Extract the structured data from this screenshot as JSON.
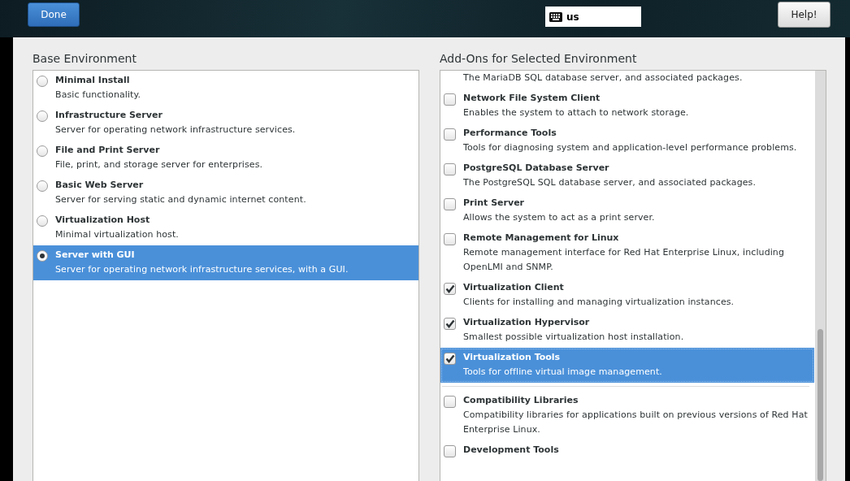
{
  "header": {
    "done_button": "Done",
    "keyboard_layout": "us",
    "help_button": "Help!"
  },
  "base_environment": {
    "title": "Base Environment",
    "items": [
      {
        "name": "Minimal Install",
        "description": "Basic functionality.",
        "selected": false
      },
      {
        "name": "Infrastructure Server",
        "description": "Server for operating network infrastructure services.",
        "selected": false
      },
      {
        "name": "File and Print Server",
        "description": "File, print, and storage server for enterprises.",
        "selected": false
      },
      {
        "name": "Basic Web Server",
        "description": "Server for serving static and dynamic internet content.",
        "selected": false
      },
      {
        "name": "Virtualization Host",
        "description": "Minimal virtualization host.",
        "selected": false
      },
      {
        "name": "Server with GUI",
        "description": "Server for operating network infrastructure services, with a GUI.",
        "selected": true
      }
    ]
  },
  "addons": {
    "title": "Add-Ons for Selected Environment",
    "environment_items": [
      {
        "description": "The MariaDB SQL database server, and associated packages.",
        "selected": false
      },
      {
        "name": "Network File System Client",
        "description": "Enables the system to attach to network storage.",
        "checked": false,
        "selected": false
      },
      {
        "name": "Performance Tools",
        "description": "Tools for diagnosing system and application-level performance problems.",
        "checked": false,
        "selected": false
      },
      {
        "name": "PostgreSQL Database Server",
        "description": "The PostgreSQL SQL database server, and associated packages.",
        "checked": false,
        "selected": false
      },
      {
        "name": "Print Server",
        "description": "Allows the system to act as a print server.",
        "checked": false,
        "selected": false
      },
      {
        "name": "Remote Management for Linux",
        "description": "Remote management interface for Red Hat Enterprise Linux, including OpenLMI and SNMP.",
        "checked": false,
        "selected": false
      },
      {
        "name": "Virtualization Client",
        "description": "Clients for installing and managing virtualization instances.",
        "checked": true,
        "selected": false
      },
      {
        "name": "Virtualization Hypervisor",
        "description": "Smallest possible virtualization host installation.",
        "checked": true,
        "selected": false
      },
      {
        "name": "Virtualization Tools",
        "description": "Tools for offline virtual image management.",
        "checked": true,
        "selected": true
      }
    ],
    "other_items": [
      {
        "name": "Compatibility Libraries",
        "description": "Compatibility libraries for applications built on previous versions of Red Hat Enterprise Linux.",
        "checked": false,
        "selected": false
      },
      {
        "name": "Development Tools",
        "checked": false,
        "selected": false
      }
    ]
  }
}
